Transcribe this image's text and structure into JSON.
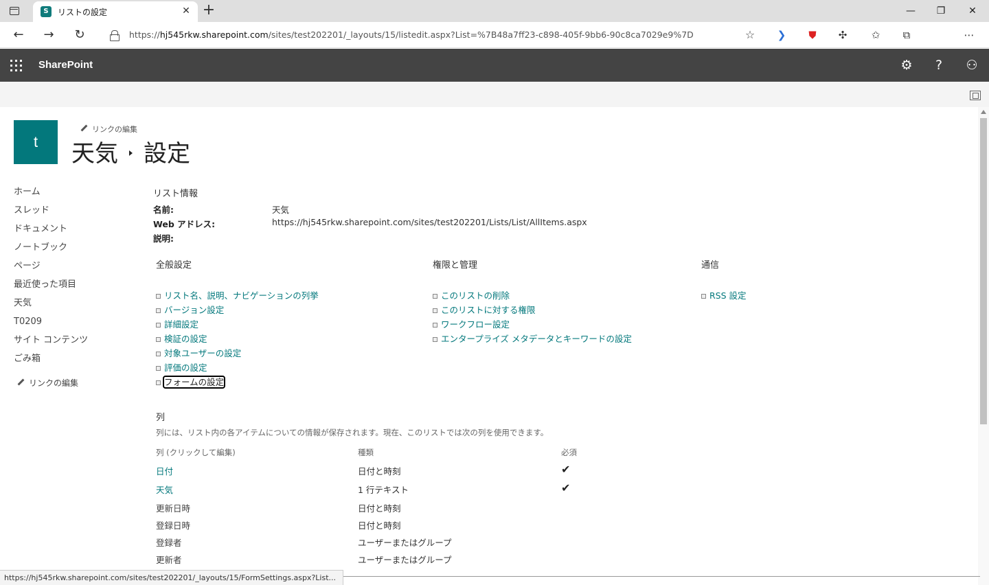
{
  "browser": {
    "tab_title": "リストの設定",
    "favicon_letter": "S",
    "url_prefix": "https://",
    "url_host": "hj545rkw.sharepoint.com",
    "url_path": "/sites/test202201/_layouts/15/listedit.aspx?List=%7B48a7ff23-c898-405f-9bb6-90c8ca7029e9%7D",
    "status_url": "https://hj545rkw.sharepoint.com/sites/test202201/_layouts/15/FormSettings.aspx?List..."
  },
  "suitebar": {
    "brand": "SharePoint",
    "color": "#444444"
  },
  "header": {
    "site_logo_letter": "t",
    "edit_links": "リンクの編集",
    "crumb_list": "天気",
    "crumb_page": "設定",
    "logo_color": "#03787c"
  },
  "leftnav": {
    "items": [
      {
        "label": "ホーム"
      },
      {
        "label": "スレッド"
      },
      {
        "label": "ドキュメント"
      },
      {
        "label": "ノートブック"
      },
      {
        "label": "ページ"
      },
      {
        "label": "最近使った項目"
      },
      {
        "label": "天気"
      },
      {
        "label": "T0209"
      },
      {
        "label": "サイト コンテンツ"
      },
      {
        "label": "ごみ箱"
      }
    ],
    "edit_links": "リンクの編集"
  },
  "list_info": {
    "heading": "リスト情報",
    "name_label": "名前:",
    "name_value": "天気",
    "web_label": "Web アドレス:",
    "web_value": "https://hj545rkw.sharepoint.com/sites/test202201/Lists/List/AllItems.aspx",
    "desc_label": "説明:"
  },
  "general": {
    "heading": "全般設定",
    "links": [
      "リスト名、説明、ナビゲーションの列挙",
      "バージョン設定",
      "詳細設定",
      "検証の設定",
      "対象ユーザーの設定",
      "評価の設定",
      "フォームの設定"
    ]
  },
  "permissions": {
    "heading": "権限と管理",
    "links": [
      "このリストの削除",
      "このリストに対する権限",
      "ワークフロー設定",
      "エンタープライズ メタデータとキーワードの設定"
    ]
  },
  "communications": {
    "heading": "通信",
    "links": [
      "RSS 設定"
    ]
  },
  "columns": {
    "heading": "列",
    "description": "列には、リスト内の各アイテムについての情報が保存されます。現在、このリストでは次の列を使用できます。",
    "col_header": "列 (クリックして編集)",
    "type_header": "種類",
    "required_header": "必須",
    "rows": [
      {
        "name": "日付",
        "type": "日付と時刻",
        "required": "✔"
      },
      {
        "name": "天気",
        "type": "1 行テキスト",
        "required": "✔"
      },
      {
        "name": "更新日時",
        "type": "日付と時刻",
        "required": ""
      },
      {
        "name": "登録日時",
        "type": "日付と時刻",
        "required": ""
      },
      {
        "name": "登録者",
        "type": "ユーザーまたはグループ",
        "required": ""
      },
      {
        "name": "更新者",
        "type": "ユーザーまたはグループ",
        "required": ""
      }
    ]
  }
}
